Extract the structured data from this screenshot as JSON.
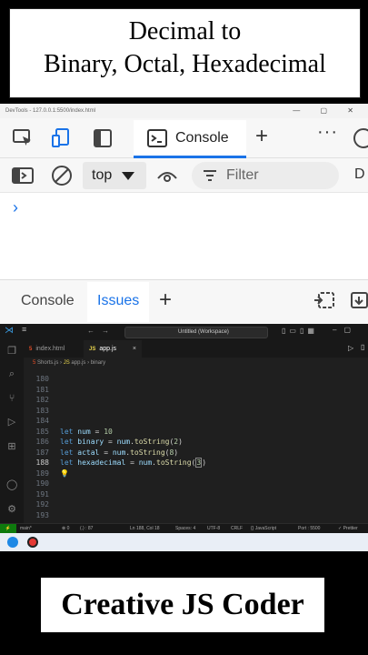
{
  "banner": {
    "title_line1": "Decimal to",
    "title_line2": "Binary, Octal, Hexadecimal",
    "footer": "Creative JS Coder"
  },
  "devtools": {
    "window_title": "DevTools - 127.0.0.1:5500/index.html",
    "active_tab": "Console",
    "context_select": "top",
    "filter_placeholder": "Filter",
    "filter_overflow": "D",
    "prompt_symbol": "›",
    "drawer_tabs": [
      {
        "label": "Console",
        "active": false
      },
      {
        "label": "Issues",
        "active": true
      }
    ],
    "accent_color": "#1a73e8"
  },
  "vscode": {
    "search_text": "Untitled (Workspace)",
    "tabs": [
      {
        "badge": "5",
        "label": "index.html",
        "active": false
      },
      {
        "badge": "JS",
        "label": "app.js",
        "active": true,
        "close": "×"
      }
    ],
    "breadcrumb": [
      {
        "badge": "5",
        "label": "Shorts.js"
      },
      {
        "badge": "JS",
        "label": "app.js"
      },
      {
        "badge": "",
        "label": "binary"
      }
    ],
    "lines": [
      {
        "n": "180"
      },
      {
        "n": "181"
      },
      {
        "n": "182"
      },
      {
        "n": "183"
      },
      {
        "n": "184"
      },
      {
        "n": "185",
        "tokens": [
          {
            "t": "let",
            "c": "kw"
          },
          {
            "t": " "
          },
          {
            "t": "num",
            "c": "var"
          },
          {
            "t": " = "
          },
          {
            "t": "10",
            "c": "num"
          }
        ]
      },
      {
        "n": "186",
        "tokens": [
          {
            "t": "let",
            "c": "kw"
          },
          {
            "t": " "
          },
          {
            "t": "binary",
            "c": "var"
          },
          {
            "t": " = "
          },
          {
            "t": "num",
            "c": "var"
          },
          {
            "t": "."
          },
          {
            "t": "toString",
            "c": "fn"
          },
          {
            "t": "("
          },
          {
            "t": "2",
            "c": "num"
          },
          {
            "t": ")"
          }
        ]
      },
      {
        "n": "187",
        "tokens": [
          {
            "t": "let",
            "c": "kw"
          },
          {
            "t": " "
          },
          {
            "t": "actal",
            "c": "var"
          },
          {
            "t": " = "
          },
          {
            "t": "num",
            "c": "var"
          },
          {
            "t": "."
          },
          {
            "t": "toString",
            "c": "fn"
          },
          {
            "t": "("
          },
          {
            "t": "8",
            "c": "num"
          },
          {
            "t": ")"
          }
        ]
      },
      {
        "n": "188",
        "current": true,
        "tokens": [
          {
            "t": "let",
            "c": "kw"
          },
          {
            "t": " "
          },
          {
            "t": "hexadecimal",
            "c": "var"
          },
          {
            "t": " = "
          },
          {
            "t": "num",
            "c": "var"
          },
          {
            "t": "."
          },
          {
            "t": "toString",
            "c": "fn"
          },
          {
            "t": "("
          },
          {
            "t": "3",
            "c": "num"
          },
          {
            "t": ")"
          }
        ]
      },
      {
        "n": "189",
        "bulb": "💡"
      },
      {
        "n": "190"
      },
      {
        "n": "191"
      },
      {
        "n": "192"
      },
      {
        "n": "193"
      }
    ],
    "status": {
      "branch": "main*",
      "errors": "⊗ 0",
      "warnings": "(.) : 87",
      "cursor": "Ln 188, Col 18",
      "spaces": "Spaces: 4",
      "encoding": "UTF-8",
      "eol": "CRLF",
      "language": "{} JavaScript",
      "port": "Port : 5500",
      "prettier": "✓ Prettier"
    }
  }
}
